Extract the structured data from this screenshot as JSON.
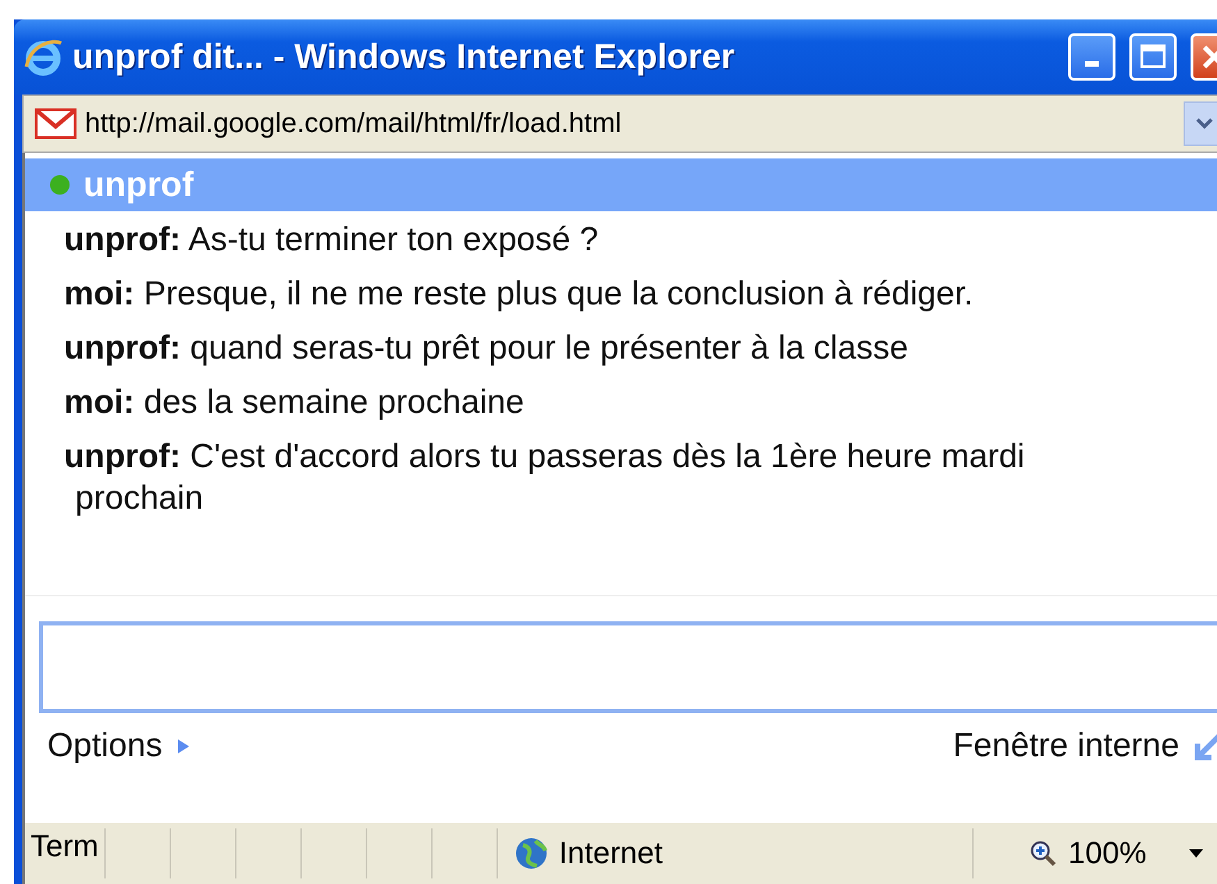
{
  "window": {
    "title": "unprof dit... - Windows Internet Explorer"
  },
  "address_bar": {
    "url": "http://mail.google.com/mail/html/fr/load.html"
  },
  "chat": {
    "contact": "unprof",
    "online": true,
    "messages": [
      {
        "text": "**unprof:** As-tu terminer ton exposé ?"
      },
      {
        "text": "**moi:** Presque, il ne me reste plus que la conclusion à rédiger."
      },
      {
        "text": "**unprof:** quand seras-tu prêt pour le présenter à la classe"
      },
      {
        "text": "**moi:** des la semaine prochaine"
      },
      {
        "text": "**unprof:** C'est d'accord alors tu passeras dès la 1ère heure mardi prochain"
      }
    ],
    "options_link": "Options",
    "popout_link": "Fenêtre interne"
  },
  "status_bar": {
    "text": "Term",
    "zone": "Internet",
    "zoom": "100%"
  }
}
